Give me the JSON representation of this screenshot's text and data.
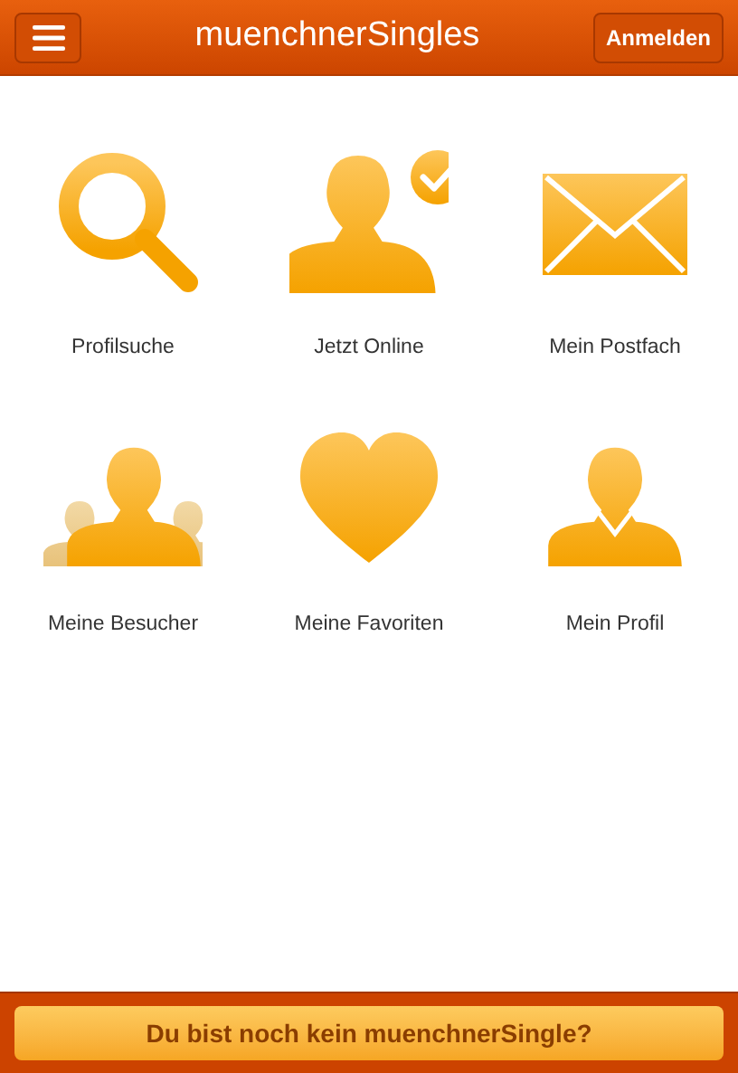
{
  "header": {
    "title": "muenchnerSingles",
    "login_button": "Anmelden"
  },
  "tiles": [
    {
      "kind": "search",
      "label": "Profilsuche"
    },
    {
      "kind": "online",
      "label": "Jetzt Online"
    },
    {
      "kind": "mail",
      "label": "Mein Postfach"
    },
    {
      "kind": "visitors",
      "label": "Meine Besucher"
    },
    {
      "kind": "favorites",
      "label": "Meine Favoriten"
    },
    {
      "kind": "profile",
      "label": "Mein Profil"
    }
  ],
  "footer": {
    "button": "Du bist noch kein muenchnerSingle?"
  }
}
